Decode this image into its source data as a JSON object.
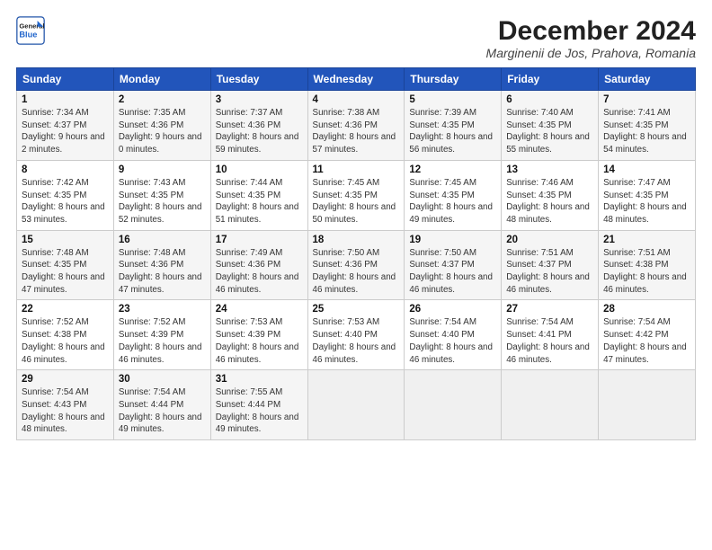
{
  "logo": {
    "line1": "General",
    "line2": "Blue"
  },
  "title": "December 2024",
  "subtitle": "Marginenii de Jos, Prahova, Romania",
  "days_of_week": [
    "Sunday",
    "Monday",
    "Tuesday",
    "Wednesday",
    "Thursday",
    "Friday",
    "Saturday"
  ],
  "weeks": [
    [
      {
        "day": 1,
        "sunrise": "Sunrise: 7:34 AM",
        "sunset": "Sunset: 4:37 PM",
        "daylight": "Daylight: 9 hours and 2 minutes."
      },
      {
        "day": 2,
        "sunrise": "Sunrise: 7:35 AM",
        "sunset": "Sunset: 4:36 PM",
        "daylight": "Daylight: 9 hours and 0 minutes."
      },
      {
        "day": 3,
        "sunrise": "Sunrise: 7:37 AM",
        "sunset": "Sunset: 4:36 PM",
        "daylight": "Daylight: 8 hours and 59 minutes."
      },
      {
        "day": 4,
        "sunrise": "Sunrise: 7:38 AM",
        "sunset": "Sunset: 4:36 PM",
        "daylight": "Daylight: 8 hours and 57 minutes."
      },
      {
        "day": 5,
        "sunrise": "Sunrise: 7:39 AM",
        "sunset": "Sunset: 4:35 PM",
        "daylight": "Daylight: 8 hours and 56 minutes."
      },
      {
        "day": 6,
        "sunrise": "Sunrise: 7:40 AM",
        "sunset": "Sunset: 4:35 PM",
        "daylight": "Daylight: 8 hours and 55 minutes."
      },
      {
        "day": 7,
        "sunrise": "Sunrise: 7:41 AM",
        "sunset": "Sunset: 4:35 PM",
        "daylight": "Daylight: 8 hours and 54 minutes."
      }
    ],
    [
      {
        "day": 8,
        "sunrise": "Sunrise: 7:42 AM",
        "sunset": "Sunset: 4:35 PM",
        "daylight": "Daylight: 8 hours and 53 minutes."
      },
      {
        "day": 9,
        "sunrise": "Sunrise: 7:43 AM",
        "sunset": "Sunset: 4:35 PM",
        "daylight": "Daylight: 8 hours and 52 minutes."
      },
      {
        "day": 10,
        "sunrise": "Sunrise: 7:44 AM",
        "sunset": "Sunset: 4:35 PM",
        "daylight": "Daylight: 8 hours and 51 minutes."
      },
      {
        "day": 11,
        "sunrise": "Sunrise: 7:45 AM",
        "sunset": "Sunset: 4:35 PM",
        "daylight": "Daylight: 8 hours and 50 minutes."
      },
      {
        "day": 12,
        "sunrise": "Sunrise: 7:45 AM",
        "sunset": "Sunset: 4:35 PM",
        "daylight": "Daylight: 8 hours and 49 minutes."
      },
      {
        "day": 13,
        "sunrise": "Sunrise: 7:46 AM",
        "sunset": "Sunset: 4:35 PM",
        "daylight": "Daylight: 8 hours and 48 minutes."
      },
      {
        "day": 14,
        "sunrise": "Sunrise: 7:47 AM",
        "sunset": "Sunset: 4:35 PM",
        "daylight": "Daylight: 8 hours and 48 minutes."
      }
    ],
    [
      {
        "day": 15,
        "sunrise": "Sunrise: 7:48 AM",
        "sunset": "Sunset: 4:35 PM",
        "daylight": "Daylight: 8 hours and 47 minutes."
      },
      {
        "day": 16,
        "sunrise": "Sunrise: 7:48 AM",
        "sunset": "Sunset: 4:36 PM",
        "daylight": "Daylight: 8 hours and 47 minutes."
      },
      {
        "day": 17,
        "sunrise": "Sunrise: 7:49 AM",
        "sunset": "Sunset: 4:36 PM",
        "daylight": "Daylight: 8 hours and 46 minutes."
      },
      {
        "day": 18,
        "sunrise": "Sunrise: 7:50 AM",
        "sunset": "Sunset: 4:36 PM",
        "daylight": "Daylight: 8 hours and 46 minutes."
      },
      {
        "day": 19,
        "sunrise": "Sunrise: 7:50 AM",
        "sunset": "Sunset: 4:37 PM",
        "daylight": "Daylight: 8 hours and 46 minutes."
      },
      {
        "day": 20,
        "sunrise": "Sunrise: 7:51 AM",
        "sunset": "Sunset: 4:37 PM",
        "daylight": "Daylight: 8 hours and 46 minutes."
      },
      {
        "day": 21,
        "sunrise": "Sunrise: 7:51 AM",
        "sunset": "Sunset: 4:38 PM",
        "daylight": "Daylight: 8 hours and 46 minutes."
      }
    ],
    [
      {
        "day": 22,
        "sunrise": "Sunrise: 7:52 AM",
        "sunset": "Sunset: 4:38 PM",
        "daylight": "Daylight: 8 hours and 46 minutes."
      },
      {
        "day": 23,
        "sunrise": "Sunrise: 7:52 AM",
        "sunset": "Sunset: 4:39 PM",
        "daylight": "Daylight: 8 hours and 46 minutes."
      },
      {
        "day": 24,
        "sunrise": "Sunrise: 7:53 AM",
        "sunset": "Sunset: 4:39 PM",
        "daylight": "Daylight: 8 hours and 46 minutes."
      },
      {
        "day": 25,
        "sunrise": "Sunrise: 7:53 AM",
        "sunset": "Sunset: 4:40 PM",
        "daylight": "Daylight: 8 hours and 46 minutes."
      },
      {
        "day": 26,
        "sunrise": "Sunrise: 7:54 AM",
        "sunset": "Sunset: 4:40 PM",
        "daylight": "Daylight: 8 hours and 46 minutes."
      },
      {
        "day": 27,
        "sunrise": "Sunrise: 7:54 AM",
        "sunset": "Sunset: 4:41 PM",
        "daylight": "Daylight: 8 hours and 46 minutes."
      },
      {
        "day": 28,
        "sunrise": "Sunrise: 7:54 AM",
        "sunset": "Sunset: 4:42 PM",
        "daylight": "Daylight: 8 hours and 47 minutes."
      }
    ],
    [
      {
        "day": 29,
        "sunrise": "Sunrise: 7:54 AM",
        "sunset": "Sunset: 4:43 PM",
        "daylight": "Daylight: 8 hours and 48 minutes."
      },
      {
        "day": 30,
        "sunrise": "Sunrise: 7:54 AM",
        "sunset": "Sunset: 4:44 PM",
        "daylight": "Daylight: 8 hours and 49 minutes."
      },
      {
        "day": 31,
        "sunrise": "Sunrise: 7:55 AM",
        "sunset": "Sunset: 4:44 PM",
        "daylight": "Daylight: 8 hours and 49 minutes."
      },
      null,
      null,
      null,
      null
    ]
  ]
}
